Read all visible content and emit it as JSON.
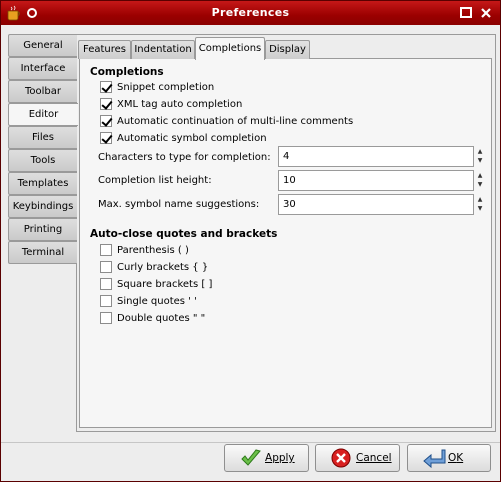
{
  "window": {
    "title": "Preferences"
  },
  "categories": [
    "General",
    "Interface",
    "Toolbar",
    "Editor",
    "Files",
    "Tools",
    "Templates",
    "Keybindings",
    "Printing",
    "Terminal"
  ],
  "active_category": "Editor",
  "tabs": [
    "Features",
    "Indentation",
    "Completions",
    "Display"
  ],
  "active_tab": "Completions",
  "completions": {
    "title": "Completions",
    "options": [
      {
        "label": "Snippet completion",
        "checked": true
      },
      {
        "label": "XML tag auto completion",
        "checked": true
      },
      {
        "label": "Automatic continuation of multi-line comments",
        "checked": true
      },
      {
        "label": "Automatic symbol completion",
        "checked": true
      }
    ],
    "fields": [
      {
        "label": "Characters to type for completion:",
        "value": "4"
      },
      {
        "label": "Completion list height:",
        "value": "10"
      },
      {
        "label": "Max. symbol name suggestions:",
        "value": "30"
      }
    ]
  },
  "autoclose": {
    "title": "Auto-close quotes and brackets",
    "options": [
      {
        "label": "Parenthesis ( )",
        "checked": false
      },
      {
        "label": "Curly brackets { }",
        "checked": false
      },
      {
        "label": "Square brackets [ ]",
        "checked": false
      },
      {
        "label": "Single quotes ' '",
        "checked": false
      },
      {
        "label": "Double quotes \" \"",
        "checked": false
      }
    ]
  },
  "buttons": {
    "apply": {
      "mnemonic": "A",
      "rest": "pply"
    },
    "cancel": {
      "mnemonic": "C",
      "rest": "ancel"
    },
    "ok": {
      "mnemonic": "O",
      "rest": "K"
    }
  },
  "colors": {
    "titlebar": "#a30000",
    "accent": "#cc2222"
  }
}
